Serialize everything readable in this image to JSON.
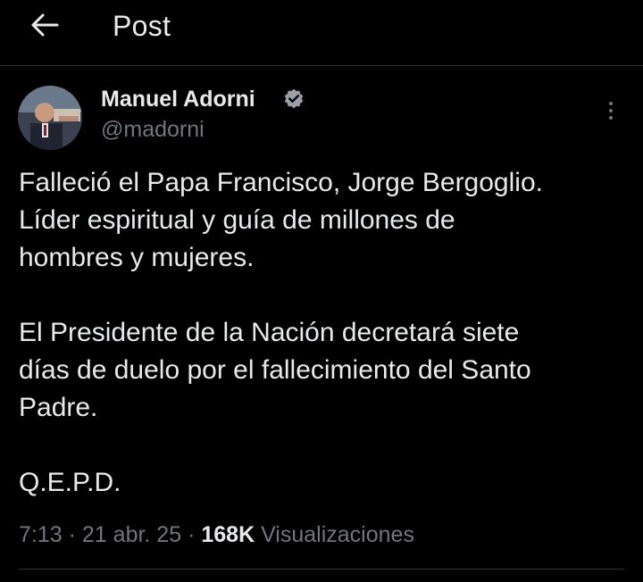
{
  "header": {
    "title": "Post",
    "back_icon": "arrow-left-icon"
  },
  "author": {
    "display_name": "Manuel Adorni",
    "handle": "@madorni",
    "verified": true,
    "verified_color": "#1d9bf0"
  },
  "tweet": {
    "paragraphs": [
      [
        "Falleció el Papa Francisco, Jorge Bergoglio.",
        "Líder espiritual y guía de millones de",
        "hombres y mujeres."
      ],
      [
        "El Presidente de la Nación decretará siete",
        "días de duelo por el fallecimiento del Santo",
        "Padre."
      ],
      [
        "Q.E.P.D."
      ]
    ]
  },
  "meta": {
    "time": "7:13",
    "separator": "·",
    "date": "21 abr. 25",
    "views_count": "168K",
    "views_label": "Visualizaciones"
  },
  "colors": {
    "background": "#000000",
    "text": "#e7e9ea",
    "muted": "#71767b",
    "divider": "#2f3336"
  }
}
